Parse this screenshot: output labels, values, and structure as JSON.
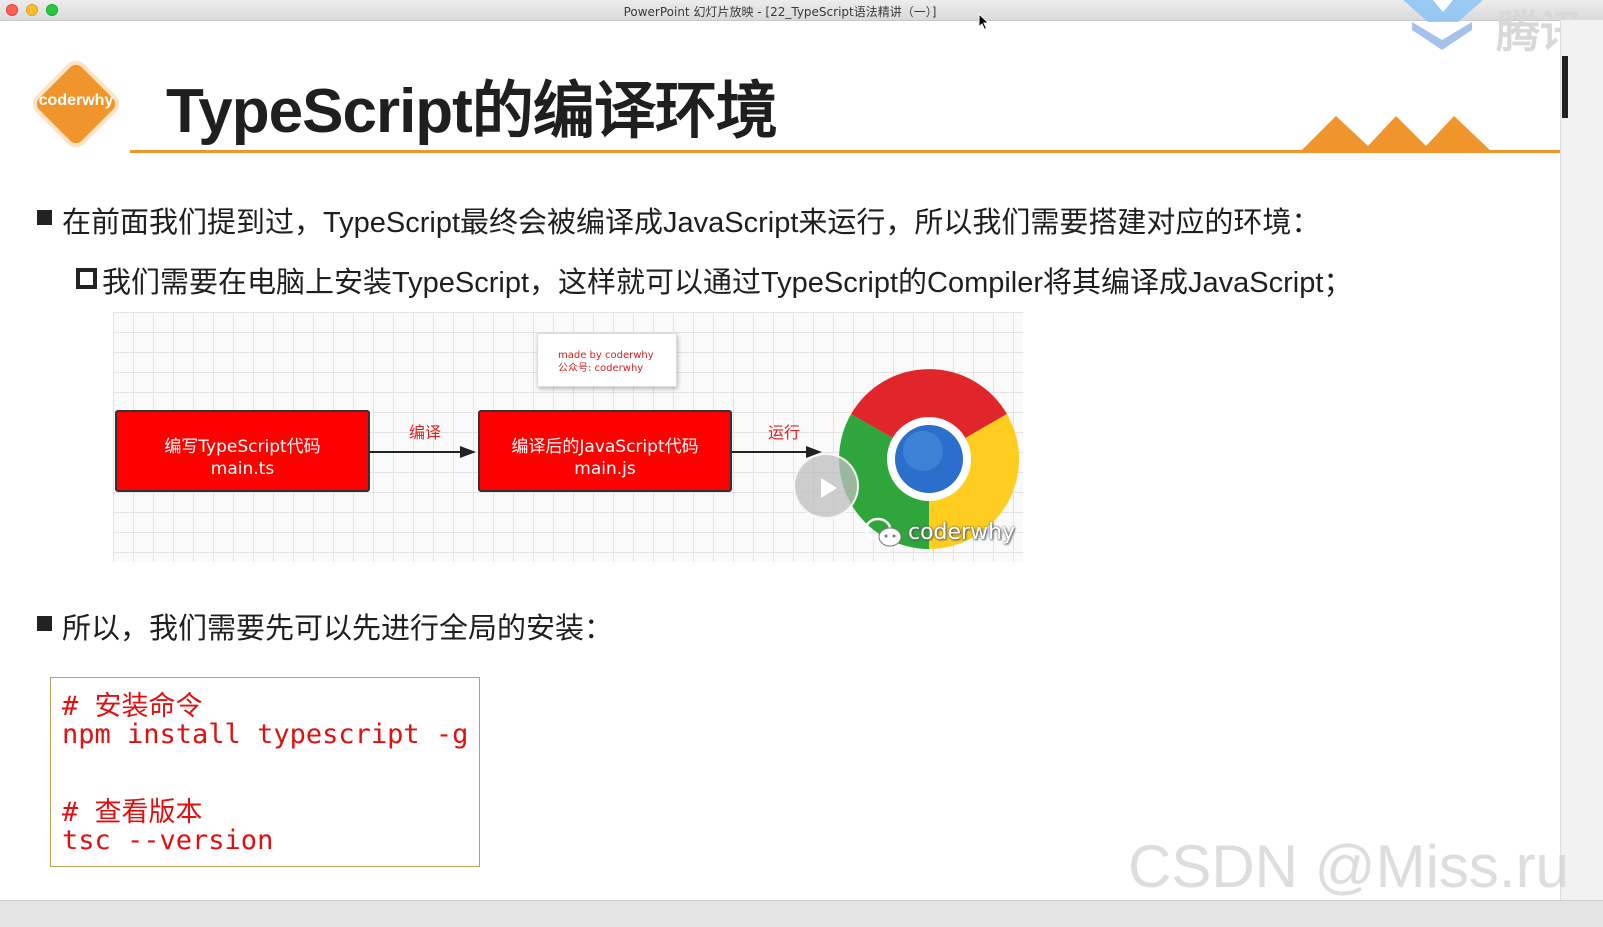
{
  "window": {
    "title": "PowerPoint 幻灯片放映 - [22_TypeScript语法精讲（一）]"
  },
  "corner_overlay": {
    "text": "腾讯"
  },
  "logo": {
    "text": "coderwhy"
  },
  "slide": {
    "title": "TypeScript的编译环境",
    "bullet1": "在前面我们提到过，TypeScript最终会被编译成JavaScript来运行，所以我们需要搭建对应的环境：",
    "sub_bullet1": "我们需要在电脑上安装TypeScript，这样就可以通过TypeScript的Compiler将其编译成JavaScript；",
    "bullet2": "所以，我们需要先可以先进行全局的安装："
  },
  "diagram": {
    "note_line1": "made by coderwhy",
    "note_line2": "公众号: coderwhy",
    "box1_line1": "编写TypeScript代码",
    "box1_line2": "main.ts",
    "arrow1_label": "编译",
    "box2_line1": "编译后的JavaScript代码",
    "box2_line2": "main.js",
    "arrow2_label": "运行",
    "watermark": "coderwhy"
  },
  "code": {
    "comment1": "# 安装命令",
    "cmd1": "npm install typescript -g",
    "comment2": "# 查看版本",
    "cmd2": "tsc --version"
  },
  "watermark": {
    "text": "CSDN @Miss.ru"
  },
  "colors": {
    "accent_orange": "#f0952b",
    "box_red": "#ff0000",
    "code_red": "#e01010"
  },
  "icons": [
    "close-icon",
    "minimize-icon",
    "zoom-icon",
    "cursor-icon",
    "play-icon",
    "chrome-icon",
    "wechat-icon"
  ]
}
